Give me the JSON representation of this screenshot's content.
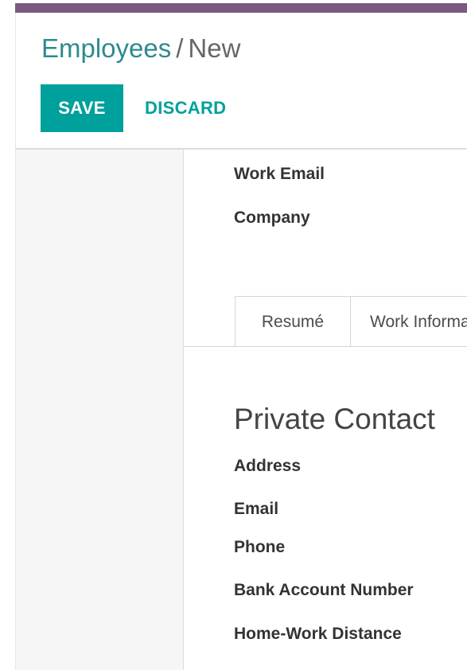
{
  "breadcrumb": {
    "parent": "Employees",
    "separator": "/",
    "current": "New"
  },
  "toolbar": {
    "save_label": "SAVE",
    "discard_label": "DISCARD"
  },
  "fields_top": {
    "work_email": "Work Email",
    "company": "Company"
  },
  "tabs": [
    {
      "label": "Resumé"
    },
    {
      "label": "Work Information"
    }
  ],
  "private_contact": {
    "title": "Private Contact",
    "address": "Address",
    "email": "Email",
    "phone": "Phone",
    "bank_account": "Bank Account Number",
    "home_work_distance": "Home-Work Distance"
  },
  "colors": {
    "top_bar": "#7c5a7f",
    "primary": "#00a09d",
    "breadcrumb_link": "#2e8a8d"
  }
}
